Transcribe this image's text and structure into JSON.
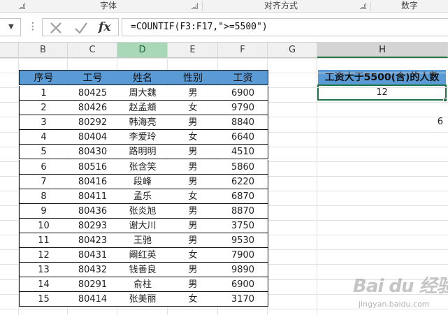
{
  "ribbon": {
    "groups": [
      {
        "label": "字体"
      },
      {
        "label": "对齐方式"
      },
      {
        "label": "数字"
      }
    ]
  },
  "formula_bar": {
    "more_dots": "⋮",
    "fx_label": "fx",
    "formula": "=COUNTIF(F3:F17,\">=5500\")"
  },
  "columns": [
    "B",
    "C",
    "D",
    "E",
    "F",
    "G",
    "H"
  ],
  "table": {
    "headers": [
      "序号",
      "工号",
      "姓名",
      "性别",
      "工资"
    ],
    "rows": [
      [
        "1",
        "80425",
        "周大魏",
        "男",
        "6900"
      ],
      [
        "2",
        "80426",
        "赵孟頫",
        "女",
        "9790"
      ],
      [
        "3",
        "80292",
        "韩海亮",
        "男",
        "8840"
      ],
      [
        "4",
        "80404",
        "李爱玲",
        "女",
        "6640"
      ],
      [
        "5",
        "80430",
        "路明明",
        "男",
        "4510"
      ],
      [
        "6",
        "80516",
        "张含笑",
        "男",
        "5860"
      ],
      [
        "7",
        "80416",
        "段峰",
        "男",
        "6220"
      ],
      [
        "8",
        "80411",
        "孟乐",
        "女",
        "6870"
      ],
      [
        "9",
        "80436",
        "张炎旭",
        "男",
        "8870"
      ],
      [
        "10",
        "80293",
        "谢大川",
        "男",
        "3750"
      ],
      [
        "11",
        "80423",
        "王驰",
        "男",
        "9530"
      ],
      [
        "12",
        "80431",
        "阚红英",
        "女",
        "7900"
      ],
      [
        "13",
        "80432",
        "钱善良",
        "男",
        "9890"
      ],
      [
        "14",
        "80291",
        "俞柱",
        "男",
        "6900"
      ],
      [
        "15",
        "80414",
        "张美丽",
        "女",
        "3170"
      ]
    ]
  },
  "summary": {
    "header": "工资大于5500(含)的人数",
    "result": "12",
    "stray_value": "6"
  },
  "watermark": {
    "logo": "Bai du 经验",
    "url": "jingyan.baidu.com"
  }
}
